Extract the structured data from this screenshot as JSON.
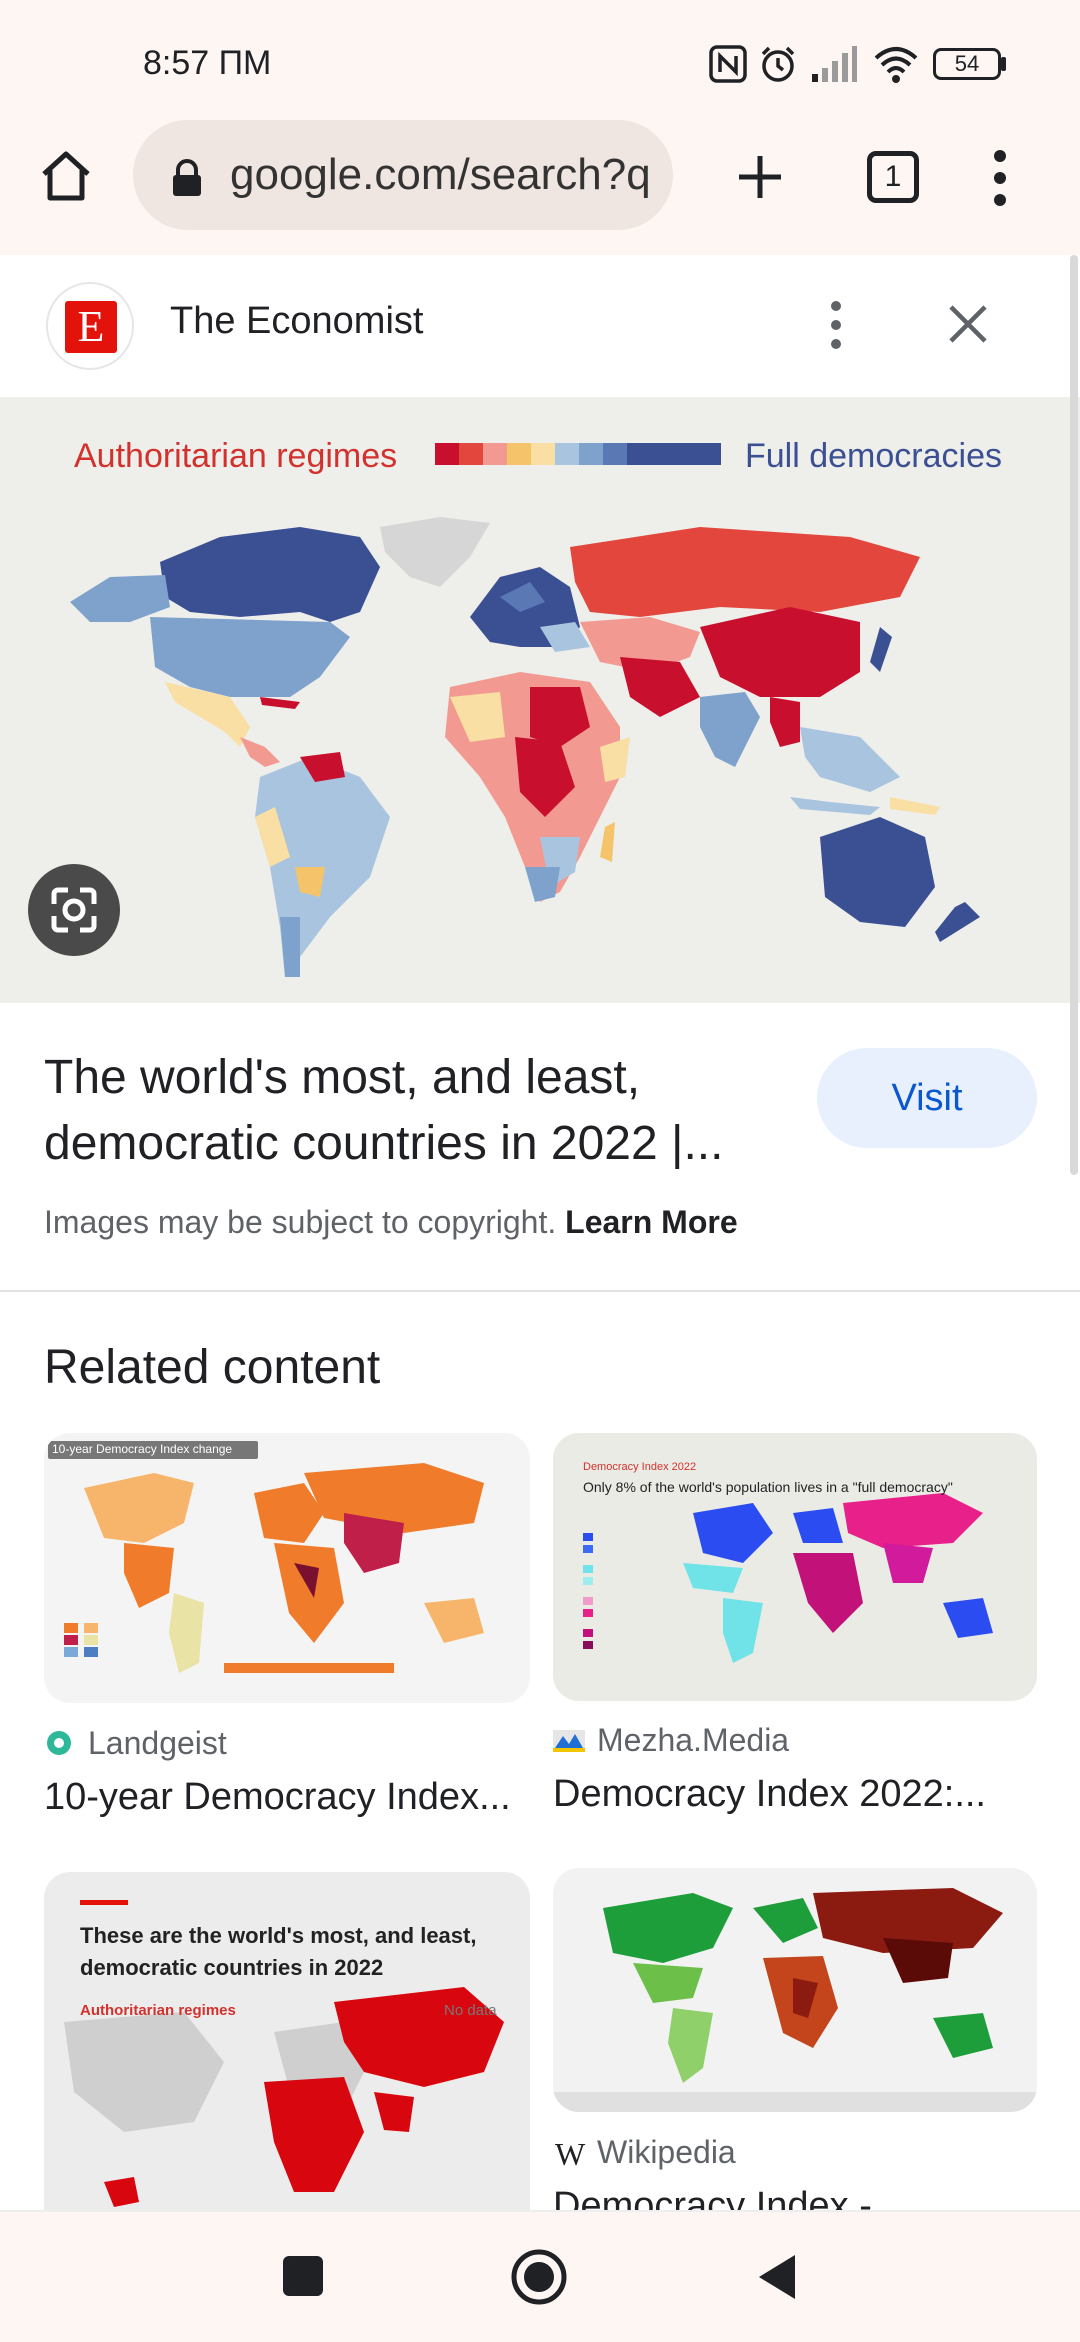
{
  "status_bar": {
    "time": "8:57 ПМ",
    "battery": "54"
  },
  "browser": {
    "url": "google.com/search?q",
    "tab_count": "1"
  },
  "source": {
    "name": "The Economist",
    "logo_letter": "E"
  },
  "image": {
    "legend_left": "Authoritarian regimes",
    "legend_right": "Full democracies",
    "legend_colors": [
      "#c8102e",
      "#e2463c",
      "#f29a91",
      "#f5c36a",
      "#f9dfa4",
      "#a9c4df",
      "#7fa2cc",
      "#5a78b4",
      "#3b4f93"
    ]
  },
  "result": {
    "title": "The world's most, and least, democratic countries in 2022 |...",
    "visit_label": "Visit",
    "copyright_text": "Images may be subject to copyright.",
    "learn_more": "Learn More"
  },
  "related": {
    "heading": "Related content",
    "cards": [
      {
        "source": "Landgeist",
        "title": "10-year Democracy Index...",
        "thumb_text": "10-year Democracy Index change"
      },
      {
        "source": "Mezha.Media",
        "title": "Democracy Index 2022:...",
        "thumb_text_small": "Democracy Index 2022",
        "thumb_text": "Only 8% of the world's population lives in a \"full democracy\""
      },
      {
        "source": "",
        "title": "",
        "thumb_text": "These are the world's most, and least, democratic countries in 2022",
        "thumb_legend": "Authoritarian regimes",
        "thumb_nodata": "No data"
      },
      {
        "source": "Wikipedia",
        "title": "Democracy Index -"
      }
    ]
  }
}
